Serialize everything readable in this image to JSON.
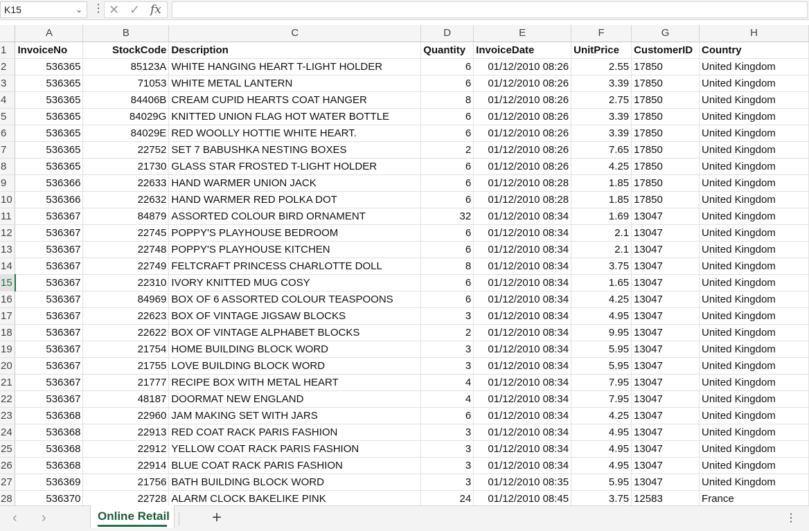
{
  "formula_bar": {
    "name_box": "K15",
    "fx_label": "fx",
    "formula_value": ""
  },
  "columns": [
    "A",
    "B",
    "C",
    "D",
    "E",
    "F",
    "G",
    "H"
  ],
  "selected_row": 15,
  "header_row": [
    "InvoiceNo",
    "StockCode",
    "Description",
    "Quantity",
    "InvoiceDate",
    "UnitPrice",
    "CustomerID",
    "Country"
  ],
  "rows": [
    [
      "536365",
      "85123A",
      "WHITE HANGING HEART T-LIGHT HOLDER",
      "6",
      "01/12/2010 08:26",
      "2.55",
      "17850",
      "United Kingdom"
    ],
    [
      "536365",
      "71053",
      "WHITE METAL LANTERN",
      "6",
      "01/12/2010 08:26",
      "3.39",
      "17850",
      "United Kingdom"
    ],
    [
      "536365",
      "84406B",
      "CREAM CUPID HEARTS COAT HANGER",
      "8",
      "01/12/2010 08:26",
      "2.75",
      "17850",
      "United Kingdom"
    ],
    [
      "536365",
      "84029G",
      "KNITTED UNION FLAG HOT WATER BOTTLE",
      "6",
      "01/12/2010 08:26",
      "3.39",
      "17850",
      "United Kingdom"
    ],
    [
      "536365",
      "84029E",
      "RED WOOLLY HOTTIE WHITE HEART.",
      "6",
      "01/12/2010 08:26",
      "3.39",
      "17850",
      "United Kingdom"
    ],
    [
      "536365",
      "22752",
      "SET 7 BABUSHKA NESTING BOXES",
      "2",
      "01/12/2010 08:26",
      "7.65",
      "17850",
      "United Kingdom"
    ],
    [
      "536365",
      "21730",
      "GLASS STAR FROSTED T-LIGHT HOLDER",
      "6",
      "01/12/2010 08:26",
      "4.25",
      "17850",
      "United Kingdom"
    ],
    [
      "536366",
      "22633",
      "HAND WARMER UNION JACK",
      "6",
      "01/12/2010 08:28",
      "1.85",
      "17850",
      "United Kingdom"
    ],
    [
      "536366",
      "22632",
      "HAND WARMER RED POLKA DOT",
      "6",
      "01/12/2010 08:28",
      "1.85",
      "17850",
      "United Kingdom"
    ],
    [
      "536367",
      "84879",
      "ASSORTED COLOUR BIRD ORNAMENT",
      "32",
      "01/12/2010 08:34",
      "1.69",
      "13047",
      "United Kingdom"
    ],
    [
      "536367",
      "22745",
      "POPPY'S PLAYHOUSE BEDROOM",
      "6",
      "01/12/2010 08:34",
      "2.1",
      "13047",
      "United Kingdom"
    ],
    [
      "536367",
      "22748",
      "POPPY'S PLAYHOUSE KITCHEN",
      "6",
      "01/12/2010 08:34",
      "2.1",
      "13047",
      "United Kingdom"
    ],
    [
      "536367",
      "22749",
      "FELTCRAFT PRINCESS CHARLOTTE DOLL",
      "8",
      "01/12/2010 08:34",
      "3.75",
      "13047",
      "United Kingdom"
    ],
    [
      "536367",
      "22310",
      "IVORY KNITTED MUG COSY",
      "6",
      "01/12/2010 08:34",
      "1.65",
      "13047",
      "United Kingdom"
    ],
    [
      "536367",
      "84969",
      "BOX OF 6 ASSORTED COLOUR TEASPOONS",
      "6",
      "01/12/2010 08:34",
      "4.25",
      "13047",
      "United Kingdom"
    ],
    [
      "536367",
      "22623",
      "BOX OF VINTAGE JIGSAW BLOCKS",
      "3",
      "01/12/2010 08:34",
      "4.95",
      "13047",
      "United Kingdom"
    ],
    [
      "536367",
      "22622",
      "BOX OF VINTAGE ALPHABET BLOCKS",
      "2",
      "01/12/2010 08:34",
      "9.95",
      "13047",
      "United Kingdom"
    ],
    [
      "536367",
      "21754",
      "HOME BUILDING BLOCK WORD",
      "3",
      "01/12/2010 08:34",
      "5.95",
      "13047",
      "United Kingdom"
    ],
    [
      "536367",
      "21755",
      "LOVE BUILDING BLOCK WORD",
      "3",
      "01/12/2010 08:34",
      "5.95",
      "13047",
      "United Kingdom"
    ],
    [
      "536367",
      "21777",
      "RECIPE BOX WITH METAL HEART",
      "4",
      "01/12/2010 08:34",
      "7.95",
      "13047",
      "United Kingdom"
    ],
    [
      "536367",
      "48187",
      "DOORMAT NEW ENGLAND",
      "4",
      "01/12/2010 08:34",
      "7.95",
      "13047",
      "United Kingdom"
    ],
    [
      "536368",
      "22960",
      "JAM MAKING SET WITH JARS",
      "6",
      "01/12/2010 08:34",
      "4.25",
      "13047",
      "United Kingdom"
    ],
    [
      "536368",
      "22913",
      "RED COAT RACK PARIS FASHION",
      "3",
      "01/12/2010 08:34",
      "4.95",
      "13047",
      "United Kingdom"
    ],
    [
      "536368",
      "22912",
      "YELLOW COAT RACK PARIS FASHION",
      "3",
      "01/12/2010 08:34",
      "4.95",
      "13047",
      "United Kingdom"
    ],
    [
      "536368",
      "22914",
      "BLUE COAT RACK PARIS FASHION",
      "3",
      "01/12/2010 08:34",
      "4.95",
      "13047",
      "United Kingdom"
    ],
    [
      "536369",
      "21756",
      "BATH BUILDING BLOCK WORD",
      "3",
      "01/12/2010 08:35",
      "5.95",
      "13047",
      "United Kingdom"
    ],
    [
      "536370",
      "22728",
      "ALARM CLOCK BAKELIKE PINK",
      "24",
      "01/12/2010 08:45",
      "3.75",
      "12583",
      "France"
    ]
  ],
  "column_align": [
    "num",
    "num",
    "txt",
    "num",
    "num",
    "num",
    "txt",
    "txt"
  ],
  "sheet_tabs": [
    {
      "label": "Online Retail",
      "active": true
    }
  ],
  "icons": {
    "cancel": "close-icon",
    "confirm": "check-icon",
    "function": "fx-icon",
    "add_sheet": "plus-icon",
    "prev": "chevron-left-icon",
    "next": "chevron-right-icon",
    "more": "more-options-icon"
  },
  "colors": {
    "accent": "#217346"
  }
}
